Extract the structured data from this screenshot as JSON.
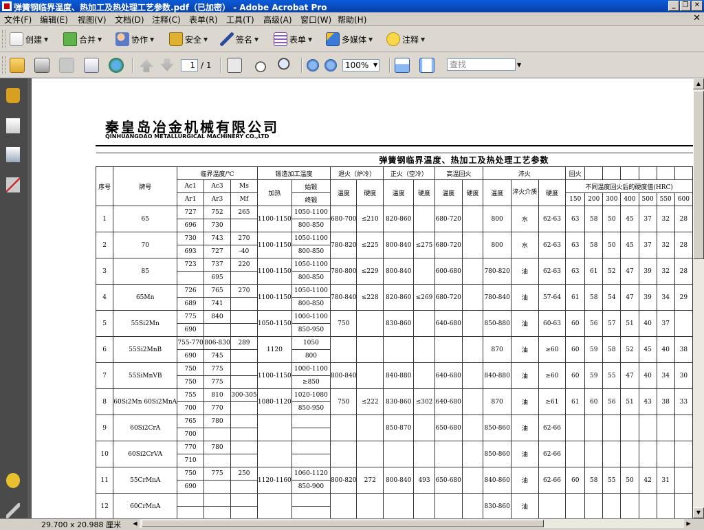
{
  "window": {
    "title": "弹簧钢临界温度、热加工及热处理工艺参数.pdf（已加密） - Adobe Acrobat Pro",
    "min_label": "_",
    "restore_label": "❐",
    "close_label": "✕"
  },
  "menu": [
    "文件(F)",
    "编辑(E)",
    "视图(V)",
    "文档(D)",
    "注释(C)",
    "表单(R)",
    "工具(T)",
    "高级(A)",
    "窗口(W)",
    "帮助(H)"
  ],
  "menu_close": "✕",
  "toolbar1": [
    {
      "label": "创建",
      "icon": "create-icon"
    },
    {
      "label": "合并",
      "icon": "combine-icon"
    },
    {
      "label": "协作",
      "icon": "collaborate-icon"
    },
    {
      "label": "安全",
      "icon": "lock-icon"
    },
    {
      "label": "签名",
      "icon": "pen-icon"
    },
    {
      "label": "表单",
      "icon": "form-icon"
    },
    {
      "label": "多媒体",
      "icon": "multimedia-icon"
    },
    {
      "label": "注释",
      "icon": "comment-icon"
    }
  ],
  "toolbar1_caret": "▼",
  "toolbar2": {
    "page_current": "1",
    "page_total": "/ 1",
    "zoom": "100%",
    "search_placeholder": "查找"
  },
  "statusbar": {
    "page_size": "29.700 x 20.988 厘米"
  },
  "document": {
    "company_cn": "秦皇岛冶金机械有限公司",
    "company_en": "QINHUANGDAO METALLURGICAL MACHINERY CO.,LTD",
    "table_title": "弹簧钢临界温度、热加工及热处理工艺参数",
    "headers": {
      "seq": "序号",
      "grade": "牌号",
      "critical": "临界温度/℃",
      "ac1": "Ac1",
      "ac3": "Ac3",
      "ms": "Ms",
      "ar1": "Ar1",
      "ar3": "Ar3",
      "mf": "Mf",
      "forging": "锻造加工温度",
      "heating": "加热",
      "start_forge": "始锻",
      "end_forge": "终锻",
      "annealing": "退火（炉冷）",
      "normalizing": "正火（空冷）",
      "hightemp": "高温回火",
      "quench": "淬火",
      "temper": "回火",
      "temp": "温度",
      "hardness": "硬度",
      "medium": "淬火介质",
      "temper_hardness": "不同温度回火后的硬度值(HRC)",
      "temper_temps": [
        "150",
        "200",
        "300",
        "400",
        "500",
        "550",
        "600"
      ]
    },
    "rows": [
      {
        "no": "1",
        "grade": "65",
        "ac1": "727",
        "ac3": "752",
        "ms": "265",
        "ar1": "696",
        "ar3": "730",
        "mf": "",
        "heat": "1100-1150",
        "start": "1050-1100",
        "end": "800-850",
        "ann_t": "680-700",
        "ann_h": "≤210",
        "nor_t": "820-860",
        "nor_h": "",
        "ht_t": "680-720",
        "ht_h": "",
        "q_t": "800",
        "q_m": "水",
        "q_h": "62-63",
        "tv": [
          "63",
          "58",
          "50",
          "45",
          "37",
          "32",
          "28"
        ]
      },
      {
        "no": "2",
        "grade": "70",
        "ac1": "730",
        "ac3": "743",
        "ms": "270",
        "ar1": "693",
        "ar3": "727",
        "mf": "-40",
        "heat": "1100-1150",
        "start": "1050-1100",
        "end": "800-850",
        "ann_t": "780-820",
        "ann_h": "≤225",
        "nor_t": "800-840",
        "nor_h": "≤275",
        "ht_t": "680-720",
        "ht_h": "",
        "q_t": "800",
        "q_m": "水",
        "q_h": "62-63",
        "tv": [
          "63",
          "58",
          "50",
          "45",
          "37",
          "32",
          "28"
        ]
      },
      {
        "no": "3",
        "grade": "85",
        "ac1": "723",
        "ac3": "737",
        "ms": "220",
        "ar1": "",
        "ar3": "695",
        "mf": "",
        "heat": "1100-1150",
        "start": "1050-1100",
        "end": "800-850",
        "ann_t": "780-800",
        "ann_h": "≤229",
        "nor_t": "800-840",
        "nor_h": "",
        "ht_t": "600-680",
        "ht_h": "",
        "q_t": "780-820",
        "q_m": "油",
        "q_h": "62-63",
        "tv": [
          "63",
          "61",
          "52",
          "47",
          "39",
          "32",
          "28"
        ]
      },
      {
        "no": "4",
        "grade": "65Mn",
        "ac1": "726",
        "ac3": "765",
        "ms": "270",
        "ar1": "689",
        "ar3": "741",
        "mf": "",
        "heat": "1100-1150",
        "start": "1050-1100",
        "end": "800-850",
        "ann_t": "780-840",
        "ann_h": "≤228",
        "nor_t": "820-860",
        "nor_h": "≤269",
        "ht_t": "680-720",
        "ht_h": "",
        "q_t": "780-840",
        "q_m": "油",
        "q_h": "57-64",
        "tv": [
          "61",
          "58",
          "54",
          "47",
          "39",
          "34",
          "29"
        ]
      },
      {
        "no": "5",
        "grade": "55Si2Mn",
        "ac1": "775",
        "ac3": "840",
        "ms": "",
        "ar1": "690",
        "ar3": "",
        "mf": "",
        "heat": "1050-1150",
        "start": "1000-1100",
        "end": "850-950",
        "ann_t": "750",
        "ann_h": "",
        "nor_t": "830-860",
        "nor_h": "",
        "ht_t": "640-680",
        "ht_h": "",
        "q_t": "850-880",
        "q_m": "油",
        "q_h": "60-63",
        "tv": [
          "60",
          "56",
          "57",
          "51",
          "40",
          "37",
          ""
        ]
      },
      {
        "no": "6",
        "grade": "55Si2MnB",
        "ac1": "755-770",
        "ac3": "806-830",
        "ms": "289",
        "ar1": "690",
        "ar3": "745",
        "mf": "",
        "heat": "1120",
        "start": "1050",
        "end": "800",
        "ann_t": "",
        "ann_h": "",
        "nor_t": "",
        "nor_h": "",
        "ht_t": "",
        "ht_h": "",
        "q_t": "870",
        "q_m": "油",
        "q_h": "≥60",
        "tv": [
          "60",
          "59",
          "58",
          "52",
          "45",
          "40",
          "38"
        ]
      },
      {
        "no": "7",
        "grade": "55SiMnVB",
        "ac1": "750",
        "ac3": "775",
        "ms": "",
        "ar1": "750",
        "ar3": "775",
        "mf": "",
        "heat": "1100-1150",
        "start": "1000-1100",
        "end": "≥850",
        "ann_t": "800-840",
        "ann_h": "",
        "nor_t": "840-880",
        "nor_h": "",
        "ht_t": "640-680",
        "ht_h": "",
        "q_t": "840-880",
        "q_m": "油",
        "q_h": "≥60",
        "tv": [
          "60",
          "59",
          "55",
          "47",
          "40",
          "34",
          "30"
        ]
      },
      {
        "no": "8",
        "grade": "60Si2Mn 60Si2MnA",
        "ac1": "755",
        "ac3": "810",
        "ms": "300-305",
        "ar1": "700",
        "ar3": "770",
        "mf": "",
        "heat": "1080-1120",
        "start": "1020-1080",
        "end": "850-950",
        "ann_t": "750",
        "ann_h": "≤222",
        "nor_t": "830-860",
        "nor_h": "≤302",
        "ht_t": "640-680",
        "ht_h": "",
        "q_t": "870",
        "q_m": "油",
        "q_h": "≥61",
        "tv": [
          "61",
          "60",
          "56",
          "51",
          "43",
          "38",
          "33"
        ]
      },
      {
        "no": "9",
        "grade": "60Si2CrA",
        "ac1": "765",
        "ac3": "780",
        "ms": "",
        "ar1": "700",
        "ar3": "",
        "mf": "",
        "heat": "",
        "start": "",
        "end": "",
        "ann_t": "",
        "ann_h": "",
        "nor_t": "850-870",
        "nor_h": "",
        "ht_t": "650-680",
        "ht_h": "",
        "q_t": "850-860",
        "q_m": "油",
        "q_h": "62-66",
        "tv": [
          "",
          "",
          "",
          "",
          "",
          "",
          ""
        ]
      },
      {
        "no": "10",
        "grade": "60Si2CrVA",
        "ac1": "770",
        "ac3": "780",
        "ms": "",
        "ar1": "710",
        "ar3": "",
        "mf": "",
        "heat": "",
        "start": "",
        "end": "",
        "ann_t": "",
        "ann_h": "",
        "nor_t": "",
        "nor_h": "",
        "ht_t": "",
        "ht_h": "",
        "q_t": "850-860",
        "q_m": "油",
        "q_h": "62-66",
        "tv": [
          "",
          "",
          "",
          "",
          "",
          "",
          ""
        ]
      },
      {
        "no": "11",
        "grade": "55CrMnA",
        "ac1": "750",
        "ac3": "775",
        "ms": "250",
        "ar1": "690",
        "ar3": "",
        "mf": "",
        "heat": "1120-1160",
        "start": "1060-1120",
        "end": "850-900",
        "ann_t": "800-820",
        "ann_h": "272",
        "nor_t": "800-840",
        "nor_h": "493",
        "ht_t": "650-680",
        "ht_h": "",
        "q_t": "840-860",
        "q_m": "油",
        "q_h": "62-66",
        "tv": [
          "60",
          "58",
          "55",
          "50",
          "42",
          "31",
          ""
        ]
      },
      {
        "no": "12",
        "grade": "60CrMnA",
        "ac1": "",
        "ac3": "",
        "ms": "",
        "ar1": "",
        "ar3": "",
        "mf": "",
        "heat": "",
        "start": "",
        "end": "",
        "ann_t": "",
        "ann_h": "",
        "nor_t": "",
        "nor_h": "",
        "ht_t": "",
        "ht_h": "",
        "q_t": "830-860",
        "q_m": "油",
        "q_h": "",
        "tv": [
          "",
          "",
          "",
          "",
          "",
          "",
          ""
        ]
      }
    ]
  },
  "colors": {
    "titlebar": "#0a4cc2",
    "sidebar": "#4a4a4a",
    "chrome": "#d4d0c8"
  }
}
